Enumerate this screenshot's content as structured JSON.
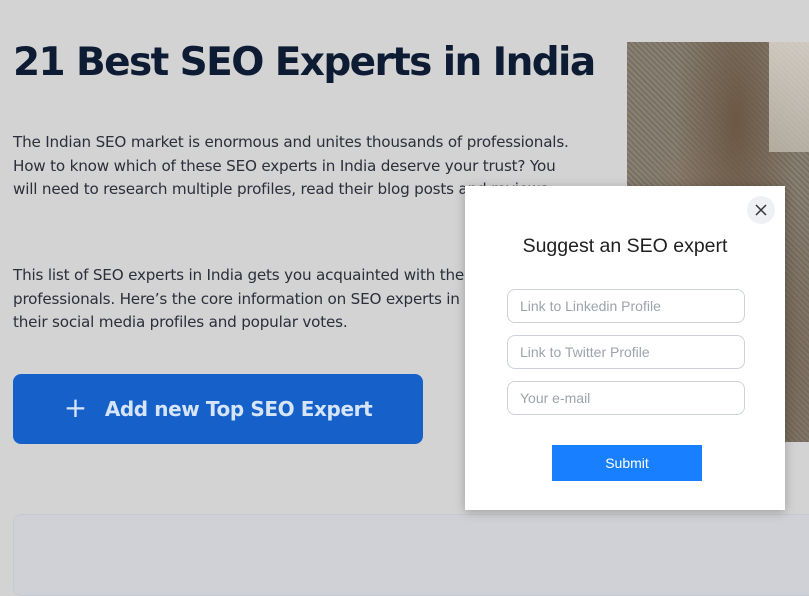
{
  "article": {
    "title": "21 Best SEO Experts in India",
    "paragraph1": "The Indian SEO market is enormous and unites thousands of professionals. How to know which of these SEO experts in India deserve your trust? You will need to research multiple profiles, read their blog posts and reviews.",
    "paragraph2": "This list of SEO experts in India gets you acquainted with the top professionals. Here’s the core information on SEO experts in India, links to their social media profiles and popular votes.",
    "add_button": {
      "icon": "plus-icon",
      "label": "Add new Top SEO Expert"
    }
  },
  "modal": {
    "title": "Suggest an SEO expert",
    "close_icon": "close-icon",
    "fields": {
      "linkedin_placeholder": "Link to Linkedin Profile",
      "twitter_placeholder": "Link to Twitter Profile",
      "email_placeholder": "Your e-mail"
    },
    "submit_label": "Submit"
  },
  "colors": {
    "overlay_bg": "#d3d3d4",
    "add_button": "#1560c9",
    "submit_button": "#1880ff",
    "title_text": "#0d1b33"
  }
}
